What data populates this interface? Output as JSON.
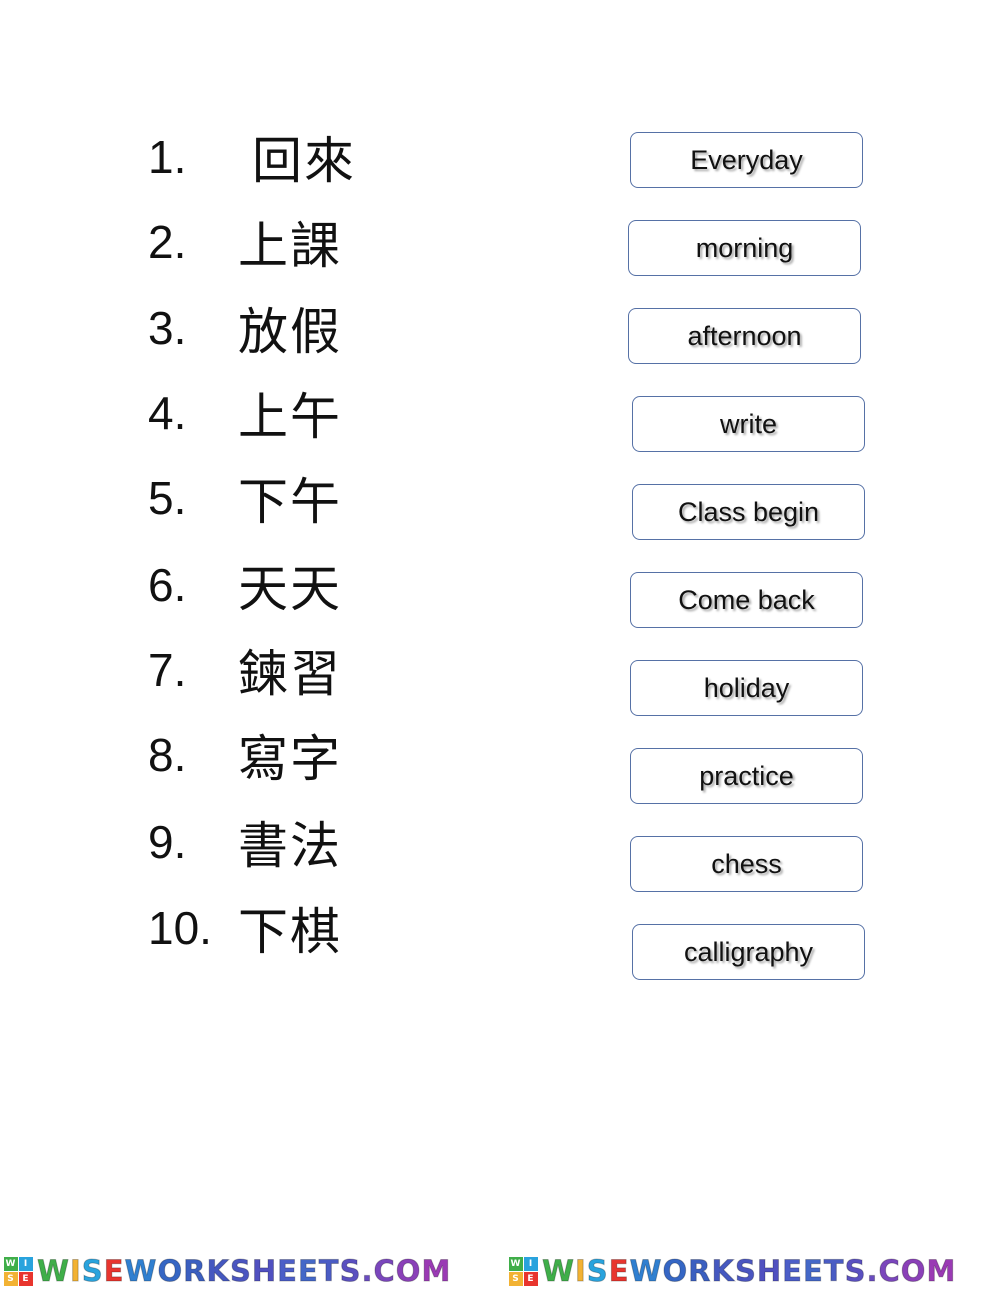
{
  "items": [
    {
      "number": "1.",
      "chinese": "回來"
    },
    {
      "number": "2.",
      "chinese": "上課"
    },
    {
      "number": "3.",
      "chinese": "放假"
    },
    {
      "number": "4.",
      "chinese": "上午"
    },
    {
      "number": "5.",
      "chinese": "下午"
    },
    {
      "number": "6.",
      "chinese": "天天"
    },
    {
      "number": "7.",
      "chinese": "鍊習"
    },
    {
      "number": "8.",
      "chinese": "寫字"
    },
    {
      "number": "9.",
      "chinese": "書法"
    },
    {
      "number": "10.",
      "chinese": "下棋"
    }
  ],
  "answers": [
    "Everyday",
    "morning",
    "afternoon",
    "write",
    "Class begin",
    "Come back",
    "holiday",
    "practice",
    "chess",
    "calligraphy"
  ],
  "footer": {
    "logo_text": "WISEWORKSHEETS.COM",
    "tile_letters": [
      "W",
      "I",
      "S",
      "E"
    ]
  },
  "colors": {
    "box_border": "#5671a6"
  }
}
